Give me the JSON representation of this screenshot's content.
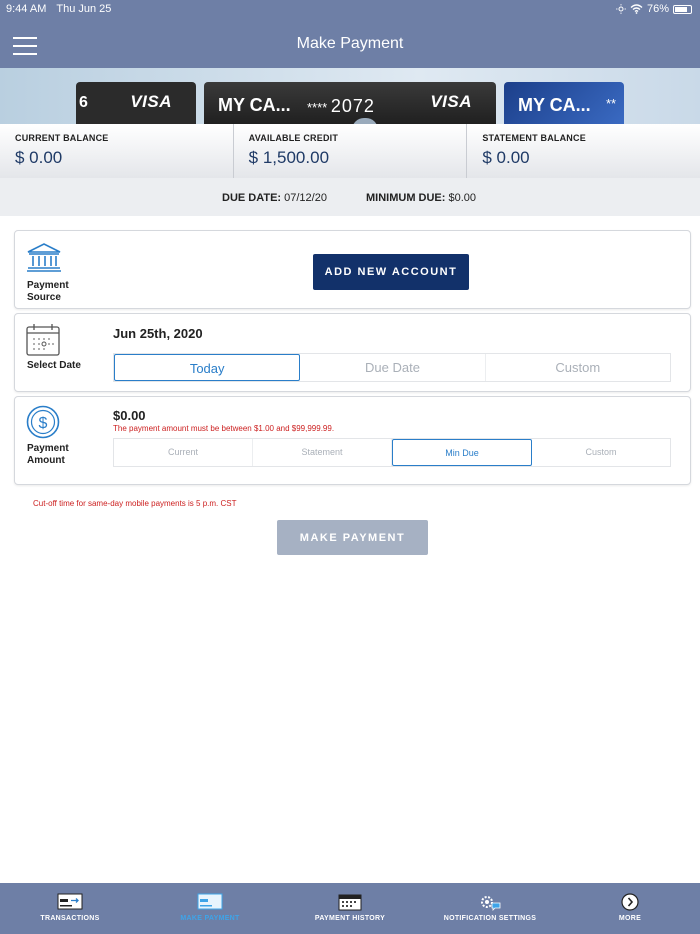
{
  "status_bar": {
    "time": "9:44 AM",
    "date": "Thu Jun 25",
    "battery": "76%"
  },
  "header": {
    "title": "Make Payment"
  },
  "cards": [
    {
      "brand": "VISA",
      "partial_digit": "6"
    },
    {
      "name": "MY CA...",
      "masked": "****",
      "last4": "2072",
      "brand": "VISA"
    },
    {
      "name": "MY CA...",
      "masked": "**"
    }
  ],
  "balances": [
    {
      "label": "CURRENT BALANCE",
      "value": "$ 0.00"
    },
    {
      "label": "AVAILABLE CREDIT",
      "value": "$ 1,500.00"
    },
    {
      "label": "STATEMENT BALANCE",
      "value": "$ 0.00"
    }
  ],
  "due": {
    "due_date_label": "DUE DATE:",
    "due_date_value": "07/12/20",
    "min_due_label": "MINIMUM DUE:",
    "min_due_value": "$0.00"
  },
  "payment_source": {
    "label_line1": "Payment",
    "label_line2": "Source",
    "button": "ADD NEW ACCOUNT"
  },
  "select_date": {
    "label": "Select Date",
    "value": "Jun 25th, 2020",
    "options": [
      "Today",
      "Due Date",
      "Custom"
    ],
    "selected": "Today"
  },
  "payment_amount": {
    "label_line1": "Payment",
    "label_line2": "Amount",
    "value": "$0.00",
    "error": "The payment amount must be between $1.00 and $99,999.99.",
    "options": [
      "Current",
      "Statement",
      "Min Due",
      "Custom"
    ],
    "selected": "Min Due"
  },
  "cutoff_note": "Cut-off time for same-day mobile payments is 5 p.m. CST",
  "make_payment_button": "MAKE PAYMENT",
  "tabs": [
    {
      "label": "TRANSACTIONS",
      "icon": "transactions-icon"
    },
    {
      "label": "MAKE PAYMENT",
      "icon": "make-payment-icon",
      "active": true
    },
    {
      "label": "PAYMENT HISTORY",
      "icon": "calendar-icon"
    },
    {
      "label": "NOTIFICATION SETTINGS",
      "icon": "gear-chat-icon"
    },
    {
      "label": "MORE",
      "icon": "chevron-circle-icon"
    }
  ],
  "colors": {
    "header": "#6e7fa6",
    "primary_button": "#12316a",
    "accent": "#2a7ec9",
    "error": "#cc1f1f"
  }
}
